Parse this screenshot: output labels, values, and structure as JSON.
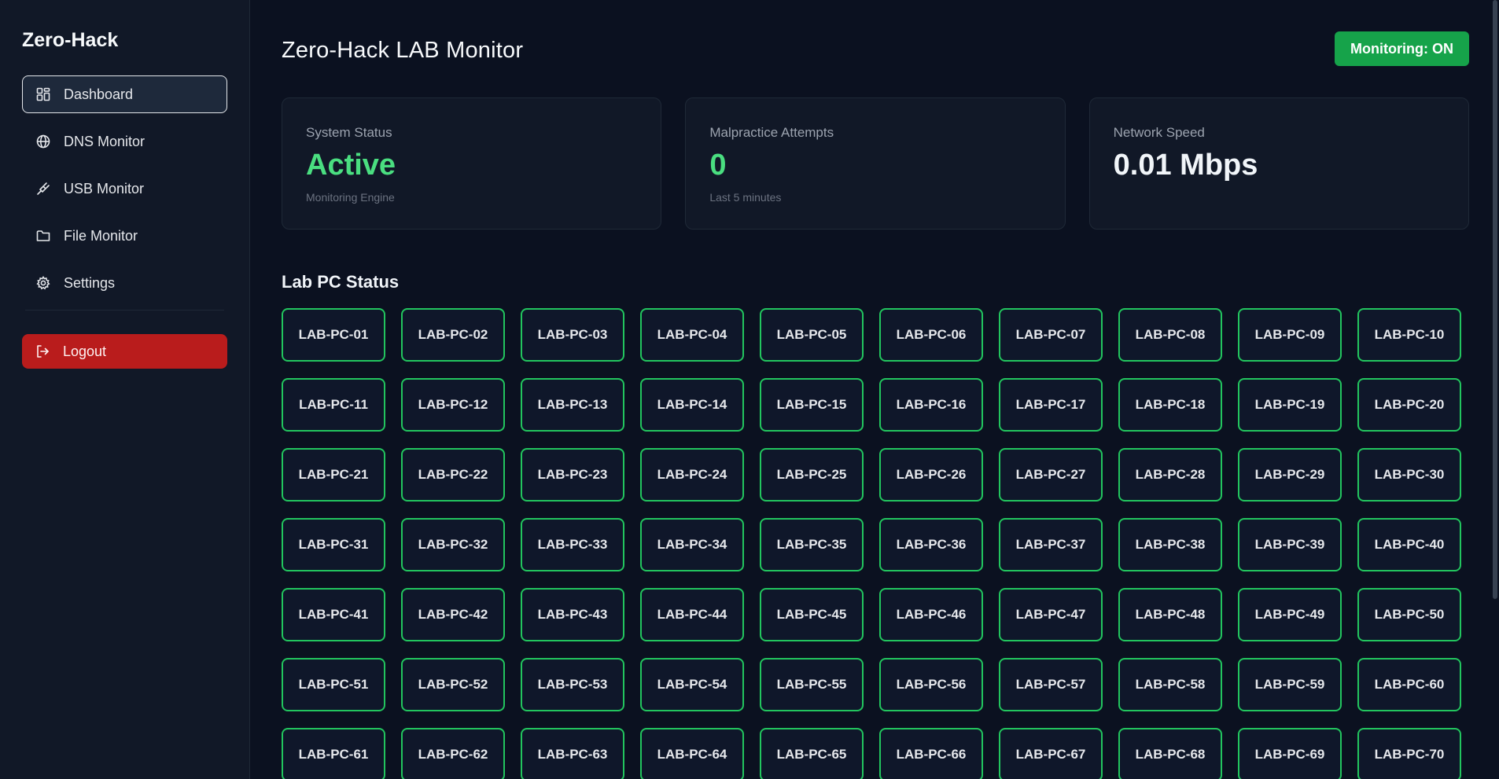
{
  "sidebar": {
    "brand": "Zero-Hack",
    "items": [
      {
        "label": "Dashboard",
        "icon": "grid-icon",
        "active": true
      },
      {
        "label": "DNS Monitor",
        "icon": "globe-icon",
        "active": false
      },
      {
        "label": "USB Monitor",
        "icon": "usb-icon",
        "active": false
      },
      {
        "label": "File Monitor",
        "icon": "folder-icon",
        "active": false
      },
      {
        "label": "Settings",
        "icon": "gear-icon",
        "active": false
      }
    ],
    "logout_label": "Logout"
  },
  "header": {
    "title": "Zero-Hack LAB Monitor",
    "monitoring_label": "Monitoring: ON"
  },
  "cards": [
    {
      "label": "System Status",
      "value": "Active",
      "sub": "Monitoring Engine"
    },
    {
      "label": "Malpractice Attempts",
      "value": "0",
      "sub": "Last 5 minutes"
    },
    {
      "label": "Network Speed",
      "value": "0.01 Mbps",
      "sub": ""
    }
  ],
  "lab": {
    "title": "Lab PC Status",
    "pcs": [
      "LAB-PC-01",
      "LAB-PC-02",
      "LAB-PC-03",
      "LAB-PC-04",
      "LAB-PC-05",
      "LAB-PC-06",
      "LAB-PC-07",
      "LAB-PC-08",
      "LAB-PC-09",
      "LAB-PC-10",
      "LAB-PC-11",
      "LAB-PC-12",
      "LAB-PC-13",
      "LAB-PC-14",
      "LAB-PC-15",
      "LAB-PC-16",
      "LAB-PC-17",
      "LAB-PC-18",
      "LAB-PC-19",
      "LAB-PC-20",
      "LAB-PC-21",
      "LAB-PC-22",
      "LAB-PC-23",
      "LAB-PC-24",
      "LAB-PC-25",
      "LAB-PC-26",
      "LAB-PC-27",
      "LAB-PC-28",
      "LAB-PC-29",
      "LAB-PC-30",
      "LAB-PC-31",
      "LAB-PC-32",
      "LAB-PC-33",
      "LAB-PC-34",
      "LAB-PC-35",
      "LAB-PC-36",
      "LAB-PC-37",
      "LAB-PC-38",
      "LAB-PC-39",
      "LAB-PC-40",
      "LAB-PC-41",
      "LAB-PC-42",
      "LAB-PC-43",
      "LAB-PC-44",
      "LAB-PC-45",
      "LAB-PC-46",
      "LAB-PC-47",
      "LAB-PC-48",
      "LAB-PC-49",
      "LAB-PC-50",
      "LAB-PC-51",
      "LAB-PC-52",
      "LAB-PC-53",
      "LAB-PC-54",
      "LAB-PC-55",
      "LAB-PC-56",
      "LAB-PC-57",
      "LAB-PC-58",
      "LAB-PC-59",
      "LAB-PC-60",
      "LAB-PC-61",
      "LAB-PC-62",
      "LAB-PC-63",
      "LAB-PC-64",
      "LAB-PC-65",
      "LAB-PC-66",
      "LAB-PC-67",
      "LAB-PC-68",
      "LAB-PC-69",
      "LAB-PC-70"
    ]
  },
  "colors": {
    "accent_green": "#22c55e",
    "status_green": "#4ade80",
    "logout_red": "#b91c1c",
    "monitor_button": "#16a34a"
  }
}
